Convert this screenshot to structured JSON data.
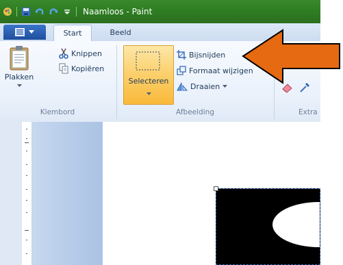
{
  "window": {
    "title": "Naamloos - Paint"
  },
  "tabs": [
    {
      "label": "Start",
      "active": true
    },
    {
      "label": "Beeld",
      "active": false
    }
  ],
  "ribbon": {
    "klembord": {
      "label": "Klembord",
      "plakken": "Plakken",
      "knippen": "Knippen",
      "kopieren": "Kopiëren"
    },
    "afbeelding": {
      "label": "Afbeelding",
      "selecteren": "Selecteren",
      "bijsnijden": "Bijsnijden",
      "formaat": "Formaat wijzigen",
      "draaien": "Draaien"
    },
    "extra": {
      "label": "Extra"
    }
  },
  "colors": {
    "titlebar": "#2f7f23",
    "selected_tool": "#fbcf6a",
    "annotation_arrow": "#e56a12"
  }
}
